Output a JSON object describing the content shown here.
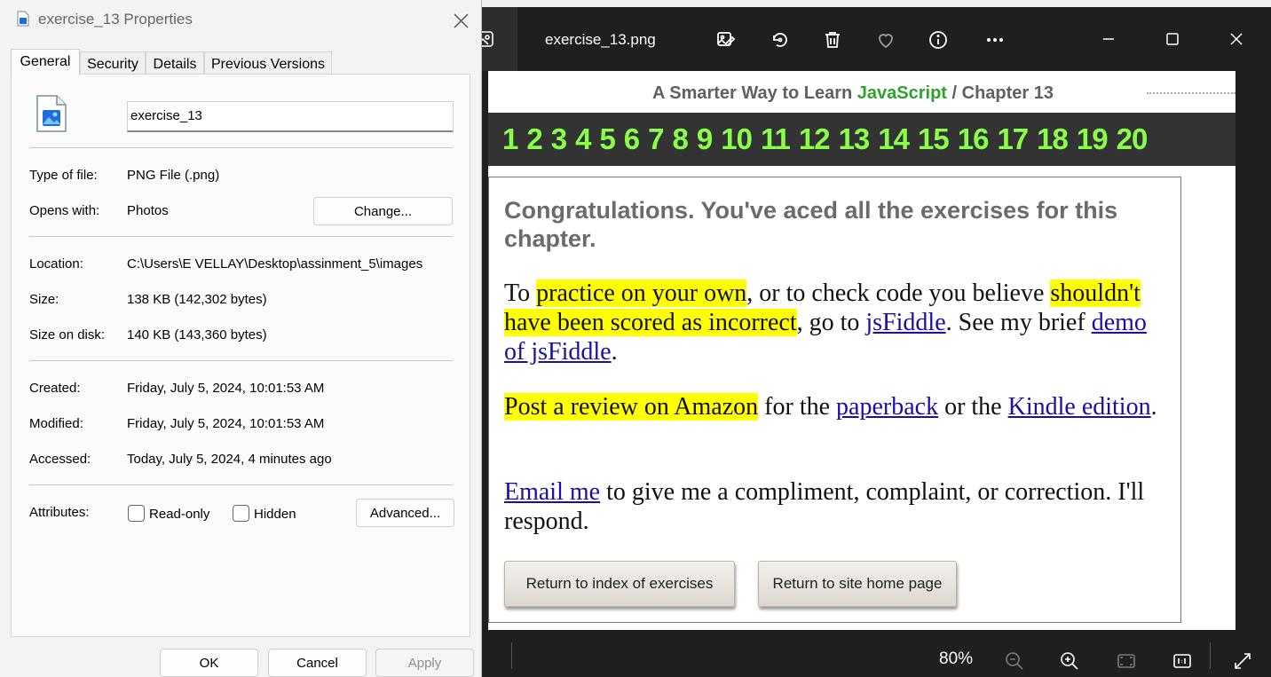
{
  "properties": {
    "title": "exercise_13 Properties",
    "tabs": [
      "General",
      "Security",
      "Details",
      "Previous Versions"
    ],
    "file_name": "exercise_13",
    "type_of_file_label": "Type of file:",
    "type_of_file": "PNG File (.png)",
    "opens_with_label": "Opens with:",
    "opens_with": "Photos",
    "change_button": "Change...",
    "location_label": "Location:",
    "location": "C:\\Users\\E VELLAY\\Desktop\\assinment_5\\images",
    "size_label": "Size:",
    "size": "138 KB (142,302 bytes)",
    "size_on_disk_label": "Size on disk:",
    "size_on_disk": "140 KB (143,360 bytes)",
    "created_label": "Created:",
    "created": "Friday, July 5, 2024, 10:01:53 AM",
    "modified_label": "Modified:",
    "modified": "Friday, July 5, 2024, 10:01:53 AM",
    "accessed_label": "Accessed:",
    "accessed": "Today, July 5, 2024, 4 minutes ago",
    "attributes_label": "Attributes:",
    "readonly_label": "Read-only",
    "hidden_label": "Hidden",
    "advanced_button": "Advanced...",
    "ok_button": "OK",
    "cancel_button": "Cancel",
    "apply_button": "Apply"
  },
  "photos": {
    "filename": "exercise_13.png",
    "zoom": "80%"
  },
  "image": {
    "header_prefix": "A Smarter Way to Learn ",
    "header_js": "JavaScript",
    "header_suffix": " / Chapter 13",
    "chapters": [
      "1",
      "2",
      "3",
      "4",
      "5",
      "6",
      "7",
      "8",
      "9",
      "10",
      "11",
      "12",
      "13",
      "14",
      "15",
      "16",
      "17",
      "18",
      "19",
      "20"
    ],
    "congrats": "Congratulations. You've aced all the exercises for this chapter.",
    "p1_a": "To ",
    "p1_hl1": "practice on your own",
    "p1_b": ", or to check code you believe ",
    "p1_hl2": "shouldn't have been scored as incorrect",
    "p1_c": ", go to ",
    "p1_link1": "jsFiddle",
    "p1_d": ". See my brief ",
    "p1_link2": "demo of jsFiddle",
    "p1_e": ".",
    "p2_hl": "Post a review on Amazon",
    "p2_a": " for the ",
    "p2_link1": "paperback",
    "p2_b": " or the ",
    "p2_link2": "Kindle edition",
    "p2_c": ".",
    "p3_link": "Email me",
    "p3_a": " to give me a compliment, complaint, or correction. I'll respond.",
    "btn_index": "Return to index of exercises",
    "btn_home": "Return to site home page"
  }
}
